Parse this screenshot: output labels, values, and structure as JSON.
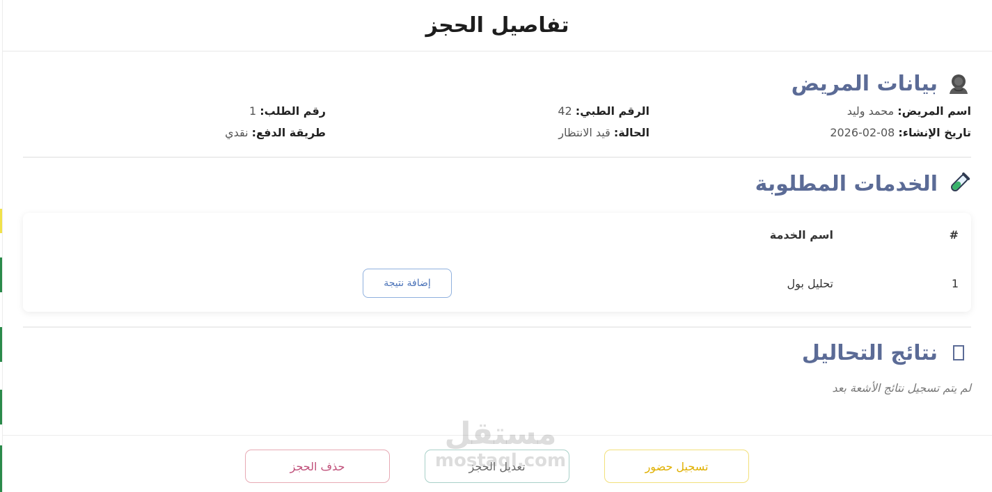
{
  "modal": {
    "title": "تفاصيل الحجز"
  },
  "patient": {
    "section_title": "بيانات المريض",
    "name_label": "اسم المريض:",
    "name_value": "محمد وليد",
    "created_label": "تاريخ الإنشاء:",
    "created_value": "2026-02-08",
    "medical_label": "الرقم الطبي:",
    "medical_value": "42",
    "status_label": "الحالة:",
    "status_value": "قيد الانتظار",
    "order_label": "رقم الطلب:",
    "order_value": "1",
    "payment_label": "طريقة الدفع:",
    "payment_value": "نقدي"
  },
  "services": {
    "section_title": "الخدمات المطلوبة",
    "columns": [
      "#",
      "اسم الخدمة"
    ],
    "rows": [
      {
        "index": "1",
        "name": "تحليل بول",
        "action_label": "إضافة نتيجة"
      }
    ]
  },
  "results": {
    "section_title": "نتائج التحاليل",
    "empty_text": "لم يتم تسجيل نتائج الأشعة بعد"
  },
  "footer": {
    "attend_label": "تسجيل حضور",
    "edit_label": "تعديل الحجز",
    "delete_label": "حذف الحجز"
  },
  "watermark": {
    "arabic": "مستقل",
    "latin": "mostaql.com"
  },
  "colors": {
    "section_title": "#5b6b96",
    "attend": "#e0b000",
    "delete": "#c0507a",
    "action_border": "#8fb0de"
  }
}
